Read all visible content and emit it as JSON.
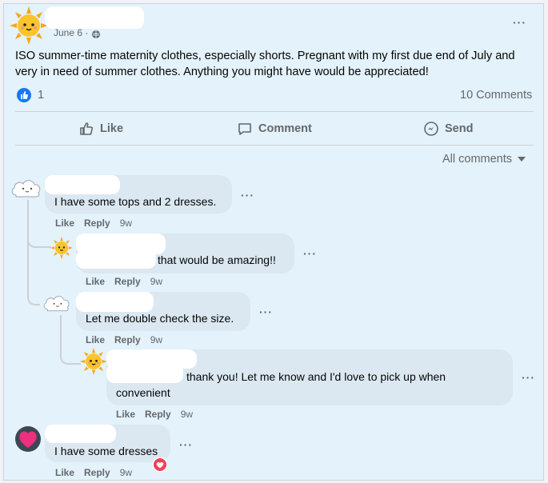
{
  "post": {
    "date": "June 6",
    "date_separator": "·",
    "text": "ISO summer-time maternity clothes, especially shorts. Pregnant with my first due end of July and very in need of summer clothes. Anything you might have would be appreciated!",
    "reaction_count": "1",
    "comment_count": "10 Comments",
    "more_label": "···"
  },
  "actions": {
    "like": "Like",
    "comment": "Comment",
    "send": "Send"
  },
  "sort": {
    "label": "All comments"
  },
  "comments": [
    {
      "text": "I have some tops and 2 dresses.",
      "like": "Like",
      "reply": "Reply",
      "time": "9w",
      "more": "···"
    },
    {
      "text": "that would be amazing!!",
      "like": "Like",
      "reply": "Reply",
      "time": "9w",
      "more": "···"
    },
    {
      "text": "Let me double check the size.",
      "like": "Like",
      "reply": "Reply",
      "time": "9w",
      "more": "···"
    },
    {
      "text": "thank you! Let me know and I'd love to pick up when",
      "text2": "convenient",
      "like": "Like",
      "reply": "Reply",
      "time": "9w",
      "more": "···"
    },
    {
      "text": "I have some dresses",
      "like": "Like",
      "reply": "Reply",
      "time": "9w",
      "more": "···"
    }
  ],
  "colors": {
    "like_blue": "#1877f2",
    "love_red": "#f33e58",
    "bubble": "#dbe8f1"
  }
}
